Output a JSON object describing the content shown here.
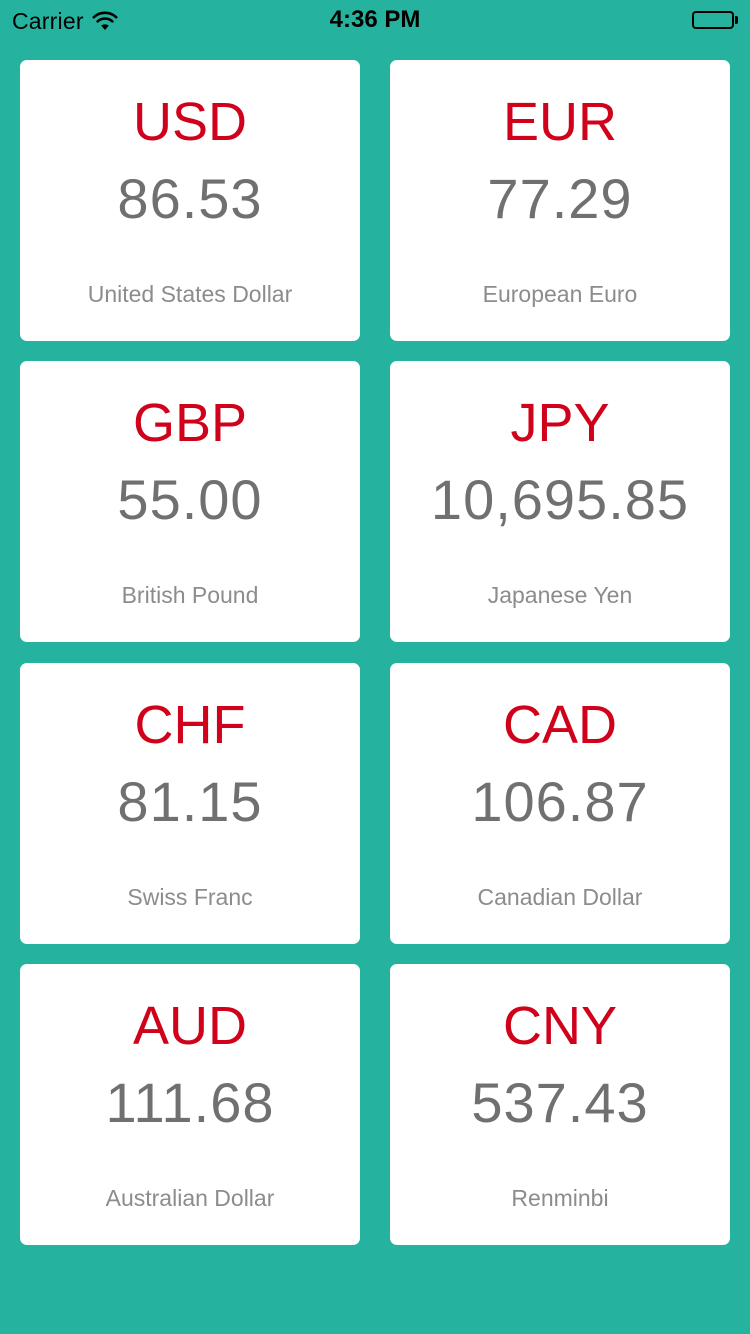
{
  "status_bar": {
    "carrier": "Carrier",
    "time": "4:36 PM",
    "icons": [
      "wifi-icon",
      "battery-icon"
    ]
  },
  "colors": {
    "background": "#25b3a0",
    "card": "#ffffff",
    "code": "#d0021b",
    "rate": "#707070",
    "name": "#8c8c8c"
  },
  "currencies": [
    {
      "code": "USD",
      "rate": "86.53",
      "name": "United States Dollar"
    },
    {
      "code": "EUR",
      "rate": "77.29",
      "name": "European Euro"
    },
    {
      "code": "GBP",
      "rate": "55.00",
      "name": "British Pound"
    },
    {
      "code": "JPY",
      "rate": "10,695.85",
      "name": "Japanese Yen"
    },
    {
      "code": "CHF",
      "rate": "81.15",
      "name": "Swiss Franc"
    },
    {
      "code": "CAD",
      "rate": "106.87",
      "name": "Canadian Dollar"
    },
    {
      "code": "AUD",
      "rate": "111.68",
      "name": "Australian Dollar"
    },
    {
      "code": "CNY",
      "rate": "537.43",
      "name": "Renminbi"
    }
  ]
}
